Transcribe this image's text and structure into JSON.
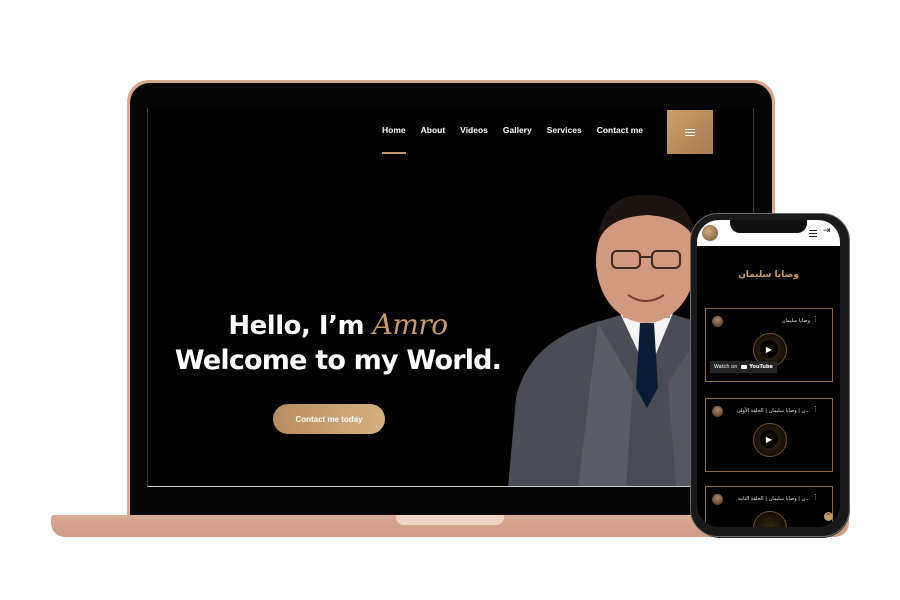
{
  "nav": {
    "items": [
      {
        "label": "Home",
        "active": true
      },
      {
        "label": "About",
        "active": false
      },
      {
        "label": "Videos",
        "active": false
      },
      {
        "label": "Gallery",
        "active": false
      },
      {
        "label": "Services",
        "active": false
      },
      {
        "label": "Contact me",
        "active": false
      }
    ],
    "menu_icon": "hamburger-icon"
  },
  "hero": {
    "greeting": "Hello, I’m ",
    "name": "Amro",
    "subtitle": "Welcome to my World.",
    "cta_label": "Contact me today"
  },
  "phone": {
    "title": "وصايا سليمان",
    "videos": [
      {
        "title": "وصايا سليمان",
        "show_watch_on": true
      },
      {
        "title": "...ن | وصايا سليمان | الحلقة الأولى",
        "show_watch_on": false
      },
      {
        "title": "...ن | وصايا سليمان | الحلقة الثانية",
        "show_watch_on": false
      }
    ],
    "watch_on": "Watch on",
    "youtube": "YouTube"
  },
  "colors": {
    "accent": "#c89b6d",
    "laptop_frame": "#d9a98f",
    "background": "#000000"
  }
}
